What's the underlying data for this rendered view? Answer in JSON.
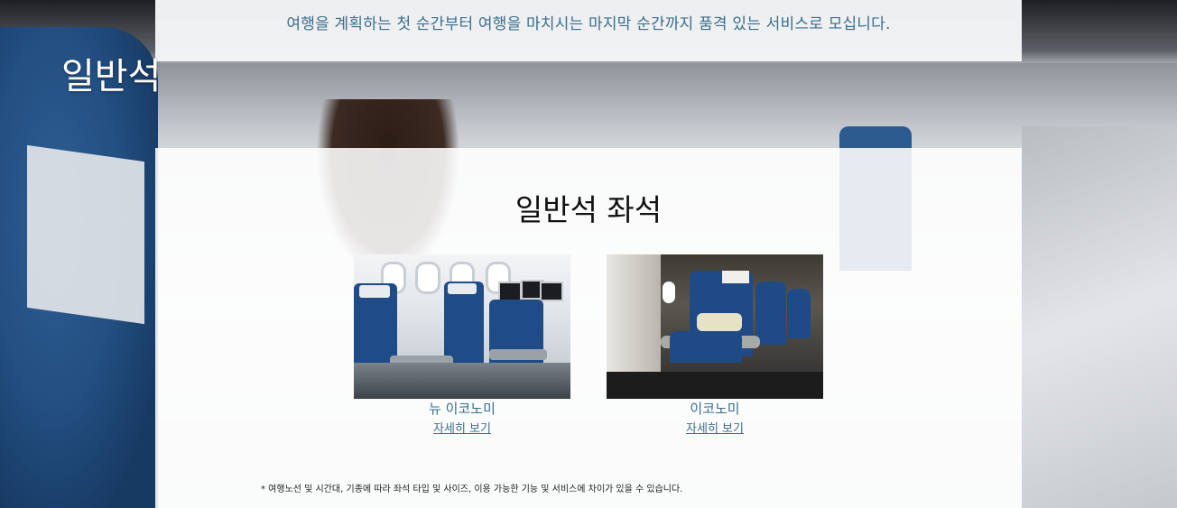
{
  "banner": {
    "text": "여행을 계획하는 첫 순간부터 여행을 마치시는 마지막 순간까지 품격 있는 서비스로 모십니다."
  },
  "hero": {
    "title": "일반석"
  },
  "section": {
    "title": "일반석 좌석",
    "cards": [
      {
        "name": "뉴 이코노미",
        "link": "자세히 보기"
      },
      {
        "name": "이코노미",
        "link": "자세히 보기"
      }
    ],
    "disclaimer": "* 여행노선 및 시간대, 기종에 따라 좌석 타입 및 사이즈, 이용 가능한 기능 및 서비스에 차이가 있을 수 있습니다."
  },
  "colors": {
    "accent_text": "#3a6d8c",
    "seat_blue": "#1f4c86"
  }
}
